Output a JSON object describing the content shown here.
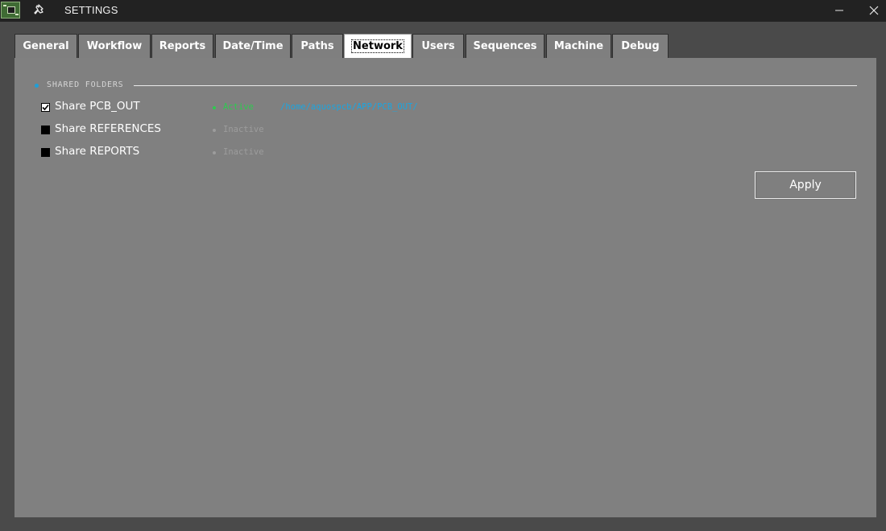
{
  "window": {
    "title": "SETTINGS"
  },
  "tabs": [
    {
      "label": "General",
      "active": false
    },
    {
      "label": "Workflow",
      "active": false
    },
    {
      "label": "Reports",
      "active": false
    },
    {
      "label": "Date/Time",
      "active": false
    },
    {
      "label": "Paths",
      "active": false
    },
    {
      "label": "Network",
      "active": true
    },
    {
      "label": "Users",
      "active": false
    },
    {
      "label": "Sequences",
      "active": false
    },
    {
      "label": "Machine",
      "active": false
    },
    {
      "label": "Debug",
      "active": false
    }
  ],
  "network": {
    "section_title": "SHARED FOLDERS",
    "shares": [
      {
        "label": "Share PCB_OUT",
        "checked": true,
        "status": "Active",
        "path": "/home/aquospcb/APP/PCB_OUT/"
      },
      {
        "label": "Share REFERENCES",
        "checked": false,
        "status": "Inactive",
        "path": ""
      },
      {
        "label": "Share REPORTS",
        "checked": false,
        "status": "Inactive",
        "path": ""
      }
    ],
    "apply_label": "Apply"
  },
  "colors": {
    "accent": "#1e9fd8",
    "active_status": "#2ec94f",
    "inactive_status": "#9c9c9c",
    "panel_bg": "#808080",
    "titlebar_bg": "#222222"
  },
  "icons": {
    "app": "pcb-board-icon",
    "pin": "pin-icon",
    "minimize": "minimize-icon",
    "close": "close-icon",
    "check": "checkmark-icon"
  }
}
